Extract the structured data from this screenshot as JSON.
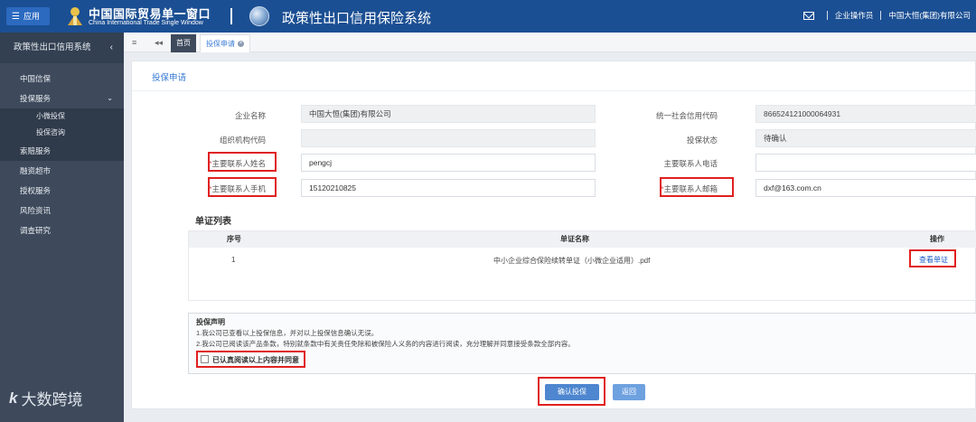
{
  "header": {
    "app_label": "应用",
    "logo_cn": "中国国际贸易单一窗口",
    "logo_en": "China International Trade Single Window",
    "system_title": "政策性出口信用保险系统",
    "role": "企业操作员",
    "company": "中国大恒(集团)有限公司"
  },
  "sidebar": {
    "title": "政策性出口信用系统",
    "items": [
      {
        "label": "中国信保"
      },
      {
        "label": "投保服务"
      },
      {
        "label": "小微投保"
      },
      {
        "label": "投保咨询"
      },
      {
        "label": "索赔服务"
      },
      {
        "label": "融资超市"
      },
      {
        "label": "授权服务"
      },
      {
        "label": "风险资讯"
      },
      {
        "label": "调查研究"
      }
    ]
  },
  "tabs": {
    "home": "首页",
    "apply": "投保申请"
  },
  "form": {
    "title": "投保申请",
    "company_name_label": "企业名称",
    "company_name_value": "中国大恒(集团)有限公司",
    "credit_code_label": "统一社会信用代码",
    "credit_code_value": "866524121000064931",
    "org_code_label": "组织机构代码",
    "org_code_value": "",
    "status_label": "投保状态",
    "status_value": "待确认",
    "contact_name_label": "主要联系人姓名",
    "contact_name_value": "pengcj",
    "contact_phone_label": "主要联系人电话",
    "contact_phone_value": "",
    "contact_mobile_label": "主要联系人手机",
    "contact_mobile_value": "15120210825",
    "contact_email_label": "主要联系人邮箱",
    "contact_email_value": "dxf@163.com.cn",
    "required_mark": "*"
  },
  "documents": {
    "title": "单证列表",
    "headers": {
      "index": "序号",
      "name": "单证名称",
      "action": "操作"
    },
    "rows": [
      {
        "index": "1",
        "name": "中小企业综合保险续转单证（小微企业适用）.pdf",
        "action": "查看单证"
      }
    ]
  },
  "declaration": {
    "title": "投保声明",
    "line1": "1.我公司已查看以上投保信息，并对以上投保信息确认无误。",
    "line2": "2.我公司已阅读该产品条款，特别就条款中有关责任免除和被保险人义务的内容进行阅读，充分理解并同意接受条款全部内容。",
    "agree_label": "已认真阅读以上内容并同意"
  },
  "buttons": {
    "confirm": "确认投保",
    "back": "返回"
  },
  "watermark": {
    "logo": "k",
    "text": "大数跨境"
  }
}
